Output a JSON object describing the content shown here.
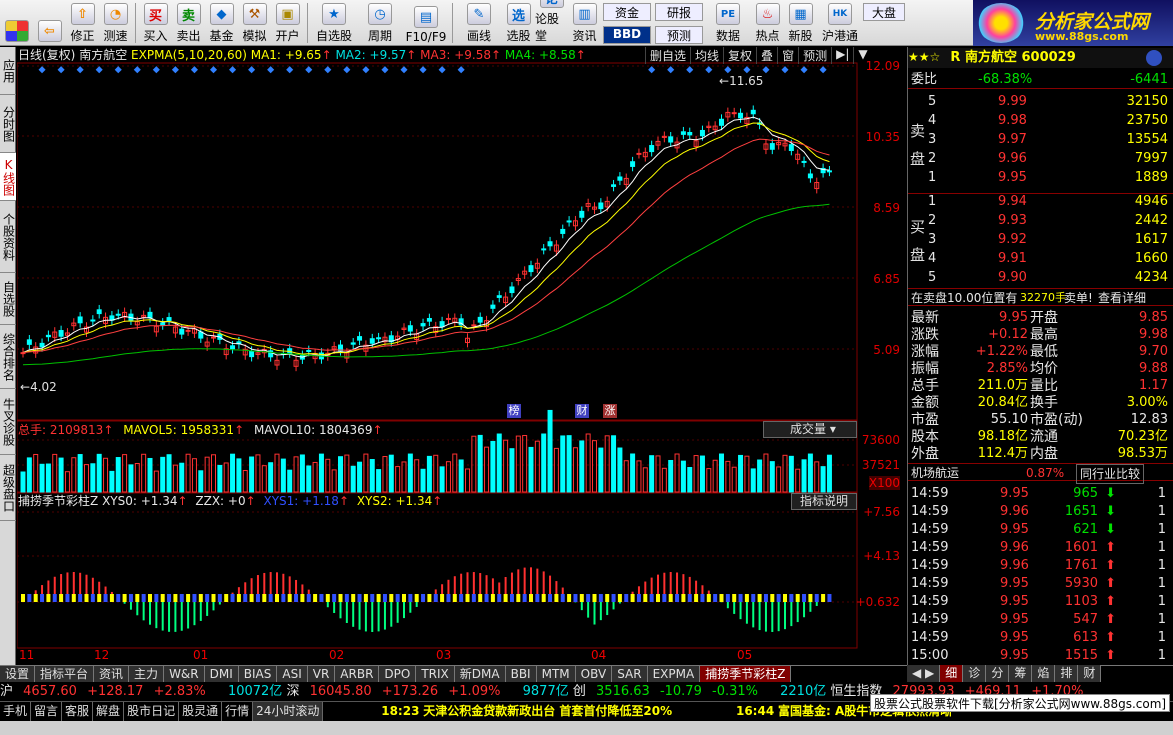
{
  "toolbar": {
    "items": [
      {
        "label": "修正",
        "icon": "arrow-up-icon"
      },
      {
        "label": "测速",
        "icon": "speedometer-icon"
      },
      {
        "label": "买入",
        "icon": "buy-icon"
      },
      {
        "label": "卖出",
        "icon": "sell-icon"
      },
      {
        "label": "基金",
        "icon": "fund-icon"
      },
      {
        "label": "模拟",
        "icon": "hammer-icon"
      },
      {
        "label": "开户",
        "icon": "lock-icon"
      },
      {
        "label": "自选股",
        "icon": "star-icon"
      },
      {
        "label": "周期",
        "icon": "clock-icon"
      },
      {
        "label": "F10/F9",
        "icon": "document-icon"
      },
      {
        "label": "画线",
        "icon": "pencil-icon"
      },
      {
        "label": "选股",
        "icon": "screen-icon"
      },
      {
        "label": "论股堂",
        "icon": "forum-icon"
      },
      {
        "label": "资讯",
        "icon": "news-icon"
      },
      {
        "label": "资金",
        "icon": "money-icon"
      },
      {
        "label": "研报",
        "icon": "report-icon"
      },
      {
        "label": "数据",
        "icon": "pe-icon"
      },
      {
        "label": "热点",
        "icon": "hot-icon"
      },
      {
        "label": "新股",
        "icon": "new-stock-icon"
      },
      {
        "label": "沪港通",
        "icon": "hk-icon"
      }
    ],
    "buttons_small": [
      "BBD",
      "预测",
      "大盘"
    ],
    "icon_labels": {
      "buy": "买",
      "sell": "卖",
      "xuan": "选",
      "lun": "论"
    }
  },
  "logo": {
    "title": "分析家公式网",
    "url": "www.88gs.com"
  },
  "left_tabs": [
    "应用",
    "分时图",
    "K线图",
    "个股资料",
    "自选股",
    "综合排名",
    "牛叉诊股",
    "超级盘口"
  ],
  "chart": {
    "header": {
      "period": "日线(复权)",
      "name": "南方航空",
      "indicator": "EXPMA(5,10,20,60)",
      "ma1": "MA1: +9.65",
      "ma2": "MA2: +9.57",
      "ma3": "MA3: +9.58",
      "ma4": "MA4: +8.58"
    },
    "top_buttons": [
      "删自选",
      "均线",
      "复权",
      "叠",
      "窗",
      "预测"
    ],
    "price_axis": [
      "12.09",
      "10.35",
      "8.59",
      "6.85",
      "5.09"
    ],
    "high_label": "11.65",
    "low_label": "4.02",
    "event_tags": [
      "榜",
      "财",
      "涨"
    ],
    "volume": {
      "label": "总手: 2109813",
      "mavol5": "MAVOL5: 1958331",
      "mavol10": "MAVOL10: 1804369",
      "dropdown": "成交量",
      "axis": [
        "73600",
        "37521",
        "X100"
      ]
    },
    "indicator": {
      "label": "捕捞季节彩柱Z",
      "xys0": "XYS0: +1.34",
      "zzx": "ZZX: +0",
      "xys1": "XYS1: +1.18",
      "xys2": "XYS2: +1.34",
      "help": "指标说明",
      "axis": [
        "+7.56",
        "+4.13",
        "+0.632"
      ]
    },
    "months": [
      "11",
      "12",
      "01",
      "02",
      "03",
      "04",
      "05"
    ],
    "colors": {
      "up": "#ff3232",
      "down": "#00ffff",
      "ma_white": "#ffffff",
      "ma_yellow": "#ffff00",
      "ma_red": "#ff4040",
      "ma_green": "#00c000"
    }
  },
  "right_panel": {
    "stars": "★★☆",
    "title": "R 南方航空 600029",
    "weibi_label": "委比",
    "weibi_pct": "-68.38%",
    "weibi_diff": "-6441",
    "sell_label": "卖盘",
    "buy_label": "买盘",
    "asks": [
      {
        "lvl": "5",
        "price": "9.99",
        "vol": "32150"
      },
      {
        "lvl": "4",
        "price": "9.98",
        "vol": "23750"
      },
      {
        "lvl": "3",
        "price": "9.97",
        "vol": "13554"
      },
      {
        "lvl": "2",
        "price": "9.96",
        "vol": "7997"
      },
      {
        "lvl": "1",
        "price": "9.95",
        "vol": "1889"
      }
    ],
    "bids": [
      {
        "lvl": "1",
        "price": "9.94",
        "vol": "4946"
      },
      {
        "lvl": "2",
        "price": "9.93",
        "vol": "2442"
      },
      {
        "lvl": "3",
        "price": "9.92",
        "vol": "1617"
      },
      {
        "lvl": "4",
        "price": "9.91",
        "vol": "1660"
      },
      {
        "lvl": "5",
        "price": "9.90",
        "vol": "4234"
      }
    ],
    "notice": "在卖盘10.00位置有",
    "notice_vol": "32270手",
    "notice_tag": "卖单!",
    "notice_link": "查看详细",
    "stats": [
      {
        "l1": "最新",
        "v1": "9.95",
        "l2": "开盘",
        "v2": "9.85"
      },
      {
        "l1": "涨跌",
        "v1": "+0.12",
        "l2": "最高",
        "v2": "9.98"
      },
      {
        "l1": "涨幅",
        "v1": "+1.22%",
        "l2": "最低",
        "v2": "9.70"
      },
      {
        "l1": "振幅",
        "v1": "2.85%",
        "l2": "均价",
        "v2": "9.88"
      },
      {
        "l1": "总手",
        "v1": "211.0万",
        "l2": "量比",
        "v2": "1.17"
      },
      {
        "l1": "金额",
        "v1": "20.84亿",
        "l2": "换手",
        "v2": "3.00%"
      },
      {
        "l1": "市盈",
        "v1": "55.10",
        "l2": "市盈(动)",
        "v2": "12.83"
      },
      {
        "l1": "股本",
        "v1": "98.18亿",
        "l2": "流通",
        "v2": "70.23亿"
      },
      {
        "l1": "外盘",
        "v1": "112.4万",
        "l2": "内盘",
        "v2": "98.53万"
      }
    ],
    "sector": "机场航运",
    "sector_pct": "0.87%",
    "sector_link": "同行业比较",
    "ticks": [
      {
        "t": "14:59",
        "p": "9.95",
        "v": "965",
        "d": "down",
        "n": "1"
      },
      {
        "t": "14:59",
        "p": "9.96",
        "v": "1651",
        "d": "down",
        "n": "1"
      },
      {
        "t": "14:59",
        "p": "9.95",
        "v": "621",
        "d": "down",
        "n": "1"
      },
      {
        "t": "14:59",
        "p": "9.96",
        "v": "1601",
        "d": "up",
        "n": "1"
      },
      {
        "t": "14:59",
        "p": "9.96",
        "v": "1761",
        "d": "up",
        "n": "1"
      },
      {
        "t": "14:59",
        "p": "9.95",
        "v": "5930",
        "d": "up",
        "n": "1"
      },
      {
        "t": "14:59",
        "p": "9.95",
        "v": "1103",
        "d": "up",
        "n": "1"
      },
      {
        "t": "14:59",
        "p": "9.95",
        "v": "547",
        "d": "up",
        "n": "1"
      },
      {
        "t": "14:59",
        "p": "9.95",
        "v": "613",
        "d": "up",
        "n": "1"
      },
      {
        "t": "15:00",
        "p": "9.95",
        "v": "1515",
        "d": "up",
        "n": "1"
      }
    ],
    "bottom_tabs": [
      "细",
      "诊",
      "分",
      "筹",
      "焰",
      "排",
      "财"
    ]
  },
  "bottom_tabs": [
    "设置",
    "指标平台",
    "资讯",
    "主力",
    "W&R",
    "DMI",
    "BIAS",
    "ASI",
    "VR",
    "ARBR",
    "DPO",
    "TRIX",
    "新DMA",
    "BBI",
    "MTM",
    "OBV",
    "SAR",
    "EXPMA",
    "捕捞季节彩柱Z"
  ],
  "index_bar": {
    "sh": "沪",
    "sh_val": "4657.60",
    "sh_chg": "+128.17",
    "sh_pct": "+2.83%",
    "sh_amt": "10072亿",
    "sz": "深",
    "sz_val": "16045.80",
    "sz_chg": "+173.26",
    "sz_pct": "+1.09%",
    "sz_amt": "9877亿",
    "cy": "创",
    "cy_val": "3516.63",
    "cy_chg": "-10.79",
    "cy_pct": "-0.31%",
    "cy_amt": "2210亿",
    "hs": "恒生指数",
    "hs_val": "27993.93",
    "hs_chg": "+469.11",
    "hs_pct": "+1.70%"
  },
  "status_bar": {
    "items": [
      "手机",
      "留言",
      "客服",
      "解盘",
      "股市日记",
      "股灵通",
      "行情",
      "24小时滚动"
    ],
    "news1_time": "18:23",
    "news1": "天津公积金贷款新政出台 首套首付降低至20%",
    "news2_time": "16:44",
    "news2": "富国基金: A股牛市逻辑依然清晰",
    "download": "股票公式股票软件下载[分析家公式网www.88gs.com]"
  }
}
